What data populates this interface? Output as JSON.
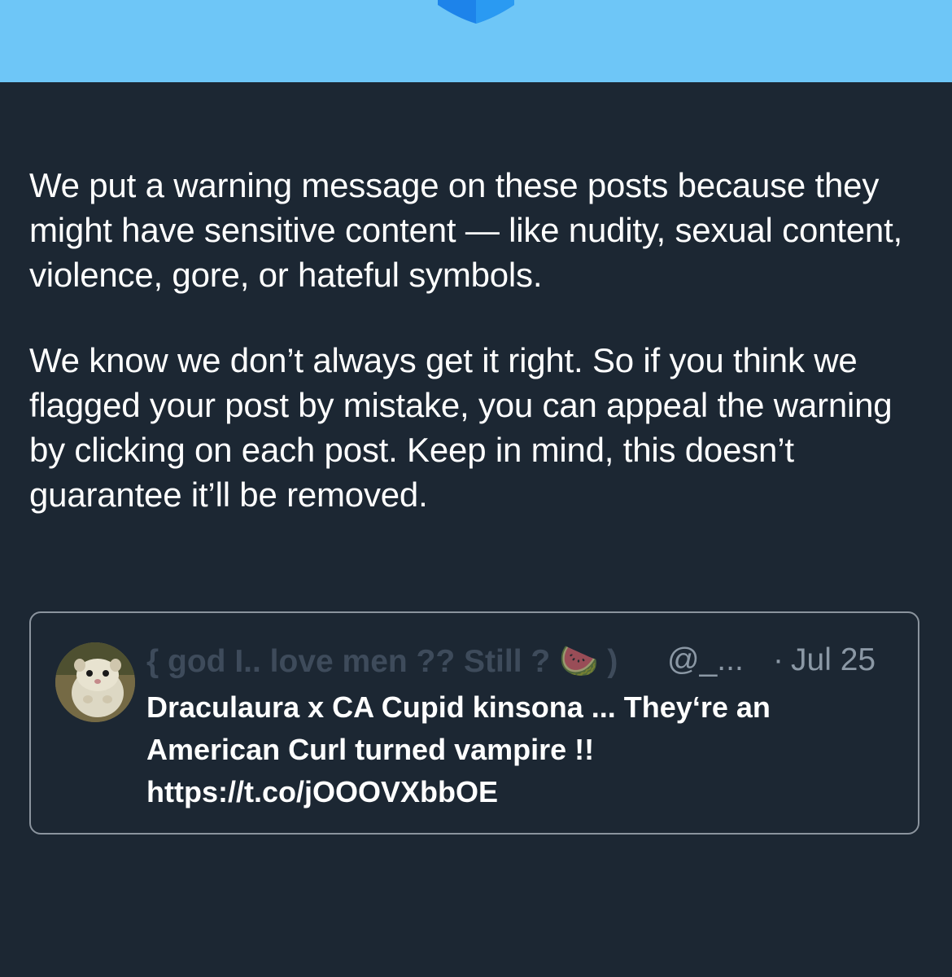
{
  "explanation": {
    "paragraph1": "We put a warning message on these posts because they might have sensitive content — like nudity, sexual content, violence, gore, or hateful symbols.",
    "paragraph2": "We know we don’t always get it right. So if you think we flagged your post by mistake, you can appeal the warning by clicking on each post. Keep in mind, this doesn’t guarantee it’ll be removed."
  },
  "tweet": {
    "display_name": "{ god I.. love men ?? Still ? 🍉 )",
    "handle": "@_...",
    "separator": "·",
    "date": "Jul 25",
    "text_line1": "Draculaura x CA Cupid kinsona ... They‘re an",
    "text_line2": "American Curl turned vampire !!",
    "text_line3": "https://t.co/jOOOVXbbOE",
    "avatar_icon": "hamster-avatar-icon"
  },
  "colors": {
    "header": "#6ec6f7",
    "background": "#1c2733",
    "text": "#ffffff",
    "muted": "#8b98a5",
    "shield": "#1877e6"
  }
}
